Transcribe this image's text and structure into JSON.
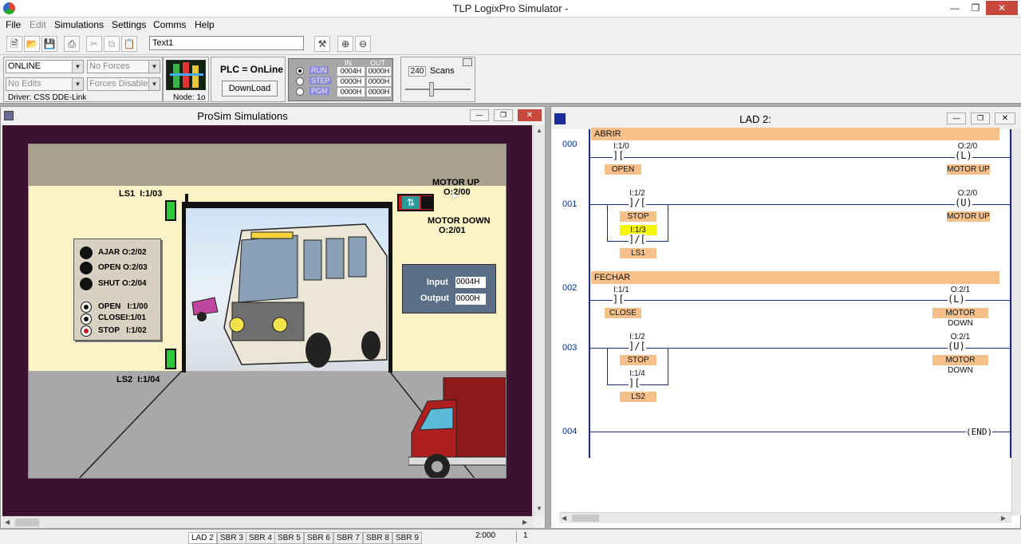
{
  "app": {
    "title": "TLP LogixPro Simulator  -"
  },
  "menu": [
    "File",
    "Edit",
    "Simulations",
    "Settings",
    "Comms",
    "Help"
  ],
  "toolbar": {
    "text_field": "Text1"
  },
  "plc_status": {
    "mode": "ONLINE",
    "forces": "No Forces",
    "edits": "No Edits",
    "forces_enabled": "Forces Disabled",
    "driver": "Driver: CSS DDE-Link",
    "node": "Node: 1o",
    "plc_label": "PLC = OnLine",
    "download": "DownLoad",
    "io_in_header": "IN",
    "io_out_header": "OUT",
    "run_modes": [
      "RUN",
      "STEP",
      "PGM"
    ],
    "in_values": [
      "0004H",
      "0000H",
      "0000H"
    ],
    "out_values": [
      "0000H",
      "0000H",
      "0000H"
    ],
    "scans_value": "240",
    "scans_label": "Scans"
  },
  "prosim": {
    "title": "ProSim Simulations",
    "motor_up": "MOTOR UP",
    "motor_up_addr": "O:2/00",
    "motor_down": "MOTOR DOWN",
    "motor_down_addr": "O:2/01",
    "ls1": "LS1  I:1/03",
    "ls2": "LS2  I:1/04",
    "lights": [
      {
        "label": "AJAR",
        "addr": "O:2/02"
      },
      {
        "label": "OPEN",
        "addr": "O:2/03"
      },
      {
        "label": "SHUT",
        "addr": "O:2/04"
      }
    ],
    "buttons": [
      {
        "label": "OPEN",
        "addr": "I:1/00"
      },
      {
        "label": "CLOSE",
        "addr": "I:1/01"
      },
      {
        "label": "STOP",
        "addr": "I:1/02"
      }
    ],
    "io_panel": {
      "input_label": "Input",
      "input_value": "0004H",
      "output_label": "Output",
      "output_value": "0000H"
    }
  },
  "lad": {
    "title": "LAD 2:",
    "rungs": [
      {
        "num": "000",
        "header": "ABRIR"
      },
      {
        "num": "001"
      },
      {
        "num": "002",
        "header": "FECHAR"
      },
      {
        "num": "003"
      },
      {
        "num": "004"
      }
    ],
    "r0": {
      "in_addr": "I:1/0",
      "in_label": "OPEN",
      "out_addr": "O:2/0",
      "out_sym": "L",
      "out_label": "MOTOR UP"
    },
    "r1": {
      "in_addr": "I:1/2",
      "in_label": "STOP",
      "par_addr": "I:1/3",
      "par_label": "LS1",
      "out_addr": "O:2/0",
      "out_sym": "U",
      "out_label": "MOTOR UP"
    },
    "r2": {
      "in_addr": "I:1/1",
      "in_label": "CLOSE",
      "out_addr": "O:2/1",
      "out_sym": "L",
      "out_label": "MOTOR DOWN"
    },
    "r3": {
      "in_addr": "I:1/2",
      "in_label": "STOP",
      "par_addr": "I:1/4",
      "par_label": "LS2",
      "out_addr": "O:2/1",
      "out_sym": "U",
      "out_label": "MOTOR DOWN"
    },
    "r4": {
      "end": "END"
    }
  },
  "statusbar": {
    "tabs": [
      "LAD 2",
      "SBR 3",
      "SBR 4",
      "SBR 5",
      "SBR 6",
      "SBR 7",
      "SBR 8",
      "SBR 9"
    ],
    "value1": "2:000",
    "value2": "1"
  }
}
